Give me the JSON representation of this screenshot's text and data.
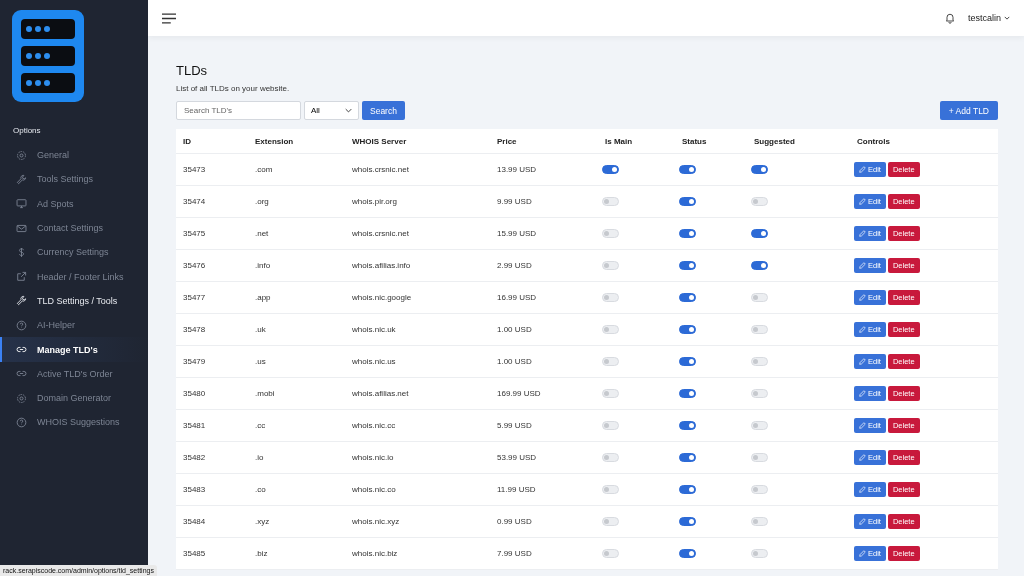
{
  "sidebar": {
    "section_label": "Options",
    "items": [
      {
        "label": "General",
        "kind": "gear",
        "selected": false,
        "hovered": false
      },
      {
        "label": "Tools Settings",
        "kind": "wrench",
        "selected": false,
        "hovered": false
      },
      {
        "label": "Ad Spots",
        "kind": "monitor",
        "selected": false,
        "hovered": false
      },
      {
        "label": "Contact Settings",
        "kind": "envelope",
        "selected": false,
        "hovered": false
      },
      {
        "label": "Currency Settings",
        "kind": "dollar",
        "selected": false,
        "hovered": false
      },
      {
        "label": "Header / Footer Links",
        "kind": "external",
        "selected": false,
        "hovered": false
      },
      {
        "label": "TLD Settings / Tools",
        "kind": "wrench",
        "selected": false,
        "hovered": true
      },
      {
        "label": "AI-Helper",
        "kind": "question",
        "selected": false,
        "hovered": false
      },
      {
        "label": "Manage TLD's",
        "kind": "link",
        "selected": true,
        "hovered": false
      },
      {
        "label": "Active TLD's Order",
        "kind": "link",
        "selected": false,
        "hovered": false
      },
      {
        "label": "Domain Generator",
        "kind": "gear",
        "selected": false,
        "hovered": false
      },
      {
        "label": "WHOIS Suggestions",
        "kind": "question",
        "selected": false,
        "hovered": false
      }
    ],
    "status_url": "rack.serapiscode.com/admin/options/tld_settings"
  },
  "topbar": {
    "user": "testcalin"
  },
  "page": {
    "title": "TLDs",
    "subtitle": "List of all TLDs on your website.",
    "search_placeholder": "Search TLD's",
    "filter": "All",
    "search_button": "Search",
    "add_button": "+ Add TLD"
  },
  "table": {
    "columns": [
      "ID",
      "Extension",
      "WHOIS Server",
      "Price",
      "Is Main",
      "Status",
      "Suggested",
      "Controls"
    ],
    "rows": [
      {
        "id": "35473",
        "extension": ".com",
        "whois": "whois.crsnic.net",
        "price": "13.99 USD",
        "is_main": true,
        "status": true,
        "suggested": true,
        "edit": "Edit",
        "delete": "Delete"
      },
      {
        "id": "35474",
        "extension": ".org",
        "whois": "whois.pir.org",
        "price": "9.99 USD",
        "is_main": false,
        "status": true,
        "suggested": false,
        "edit": "Edit",
        "delete": "Delete"
      },
      {
        "id": "35475",
        "extension": ".net",
        "whois": "whois.crsnic.net",
        "price": "15.99 USD",
        "is_main": false,
        "status": true,
        "suggested": true,
        "edit": "Edit",
        "delete": "Delete"
      },
      {
        "id": "35476",
        "extension": ".info",
        "whois": "whois.afilias.info",
        "price": "2.99 USD",
        "is_main": false,
        "status": true,
        "suggested": true,
        "edit": "Edit",
        "delete": "Delete"
      },
      {
        "id": "35477",
        "extension": ".app",
        "whois": "whois.nic.google",
        "price": "16.99 USD",
        "is_main": false,
        "status": true,
        "suggested": false,
        "edit": "Edit",
        "delete": "Delete"
      },
      {
        "id": "35478",
        "extension": ".uk",
        "whois": "whois.nic.uk",
        "price": "1.00 USD",
        "is_main": false,
        "status": true,
        "suggested": false,
        "edit": "Edit",
        "delete": "Delete"
      },
      {
        "id": "35479",
        "extension": ".us",
        "whois": "whois.nic.us",
        "price": "1.00 USD",
        "is_main": false,
        "status": true,
        "suggested": false,
        "edit": "Edit",
        "delete": "Delete"
      },
      {
        "id": "35480",
        "extension": ".mobi",
        "whois": "whois.afilias.net",
        "price": "169.99 USD",
        "is_main": false,
        "status": true,
        "suggested": false,
        "edit": "Edit",
        "delete": "Delete"
      },
      {
        "id": "35481",
        "extension": ".cc",
        "whois": "whois.nic.cc",
        "price": "5.99 USD",
        "is_main": false,
        "status": true,
        "suggested": false,
        "edit": "Edit",
        "delete": "Delete"
      },
      {
        "id": "35482",
        "extension": ".io",
        "whois": "whois.nic.io",
        "price": "53.99 USD",
        "is_main": false,
        "status": true,
        "suggested": false,
        "edit": "Edit",
        "delete": "Delete"
      },
      {
        "id": "35483",
        "extension": ".co",
        "whois": "whois.nic.co",
        "price": "11.99 USD",
        "is_main": false,
        "status": true,
        "suggested": false,
        "edit": "Edit",
        "delete": "Delete"
      },
      {
        "id": "35484",
        "extension": ".xyz",
        "whois": "whois.nic.xyz",
        "price": "0.99 USD",
        "is_main": false,
        "status": true,
        "suggested": false,
        "edit": "Edit",
        "delete": "Delete"
      },
      {
        "id": "35485",
        "extension": ".biz",
        "whois": "whois.nic.biz",
        "price": "7.99 USD",
        "is_main": false,
        "status": true,
        "suggested": false,
        "edit": "Edit",
        "delete": "Delete"
      }
    ]
  }
}
